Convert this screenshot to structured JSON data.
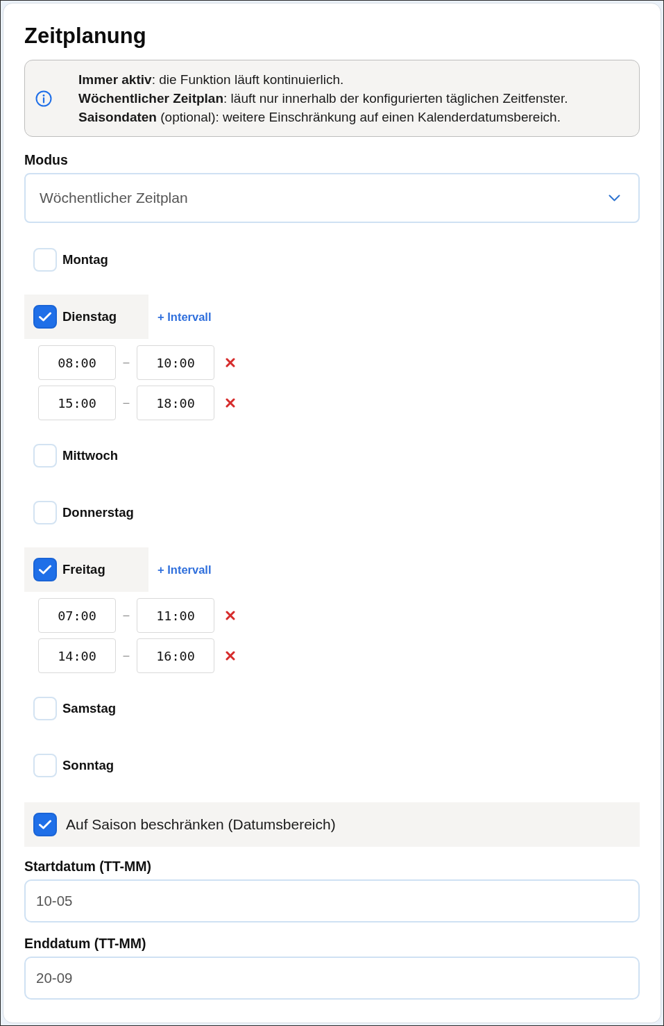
{
  "title": "Zeitplanung",
  "info": {
    "lines": [
      "**Immer aktiv**: die Funktion läuft kontinuierlich.",
      "**Wöchentlicher Zeitplan**: läuft nur innerhalb der konfigurierten täglichen Zeitfenster.",
      "**Saisondaten** (optional): weitere Einschränkung auf einen Kalenderdatumsbereich."
    ]
  },
  "mode": {
    "label": "Modus",
    "value": "Wöchentlicher Zeitplan"
  },
  "days": [
    {
      "label": "Montag",
      "checked": false
    },
    {
      "label": "Dienstag",
      "checked": true,
      "add_label": "+ Intervall",
      "intervals": [
        {
          "start": "08:00",
          "separator": "–",
          "end": "10:00"
        },
        {
          "start": "15:00",
          "separator": "–",
          "end": "18:00"
        }
      ]
    },
    {
      "label": "Mittwoch",
      "checked": false
    },
    {
      "label": "Donnerstag",
      "checked": false
    },
    {
      "label": "Freitag",
      "checked": true,
      "add_label": "+ Intervall",
      "intervals": [
        {
          "start": "07:00",
          "separator": "–",
          "end": "11:00"
        },
        {
          "start": "14:00",
          "separator": "–",
          "end": "16:00"
        }
      ]
    },
    {
      "label": "Samstag",
      "checked": false
    },
    {
      "label": "Sonntag",
      "checked": false
    }
  ],
  "season": {
    "label": "Auf Saison beschränken (Datumsbereich)",
    "checked": true
  },
  "start_date": {
    "label": "Startdatum (TT-MM)",
    "value": "10-05"
  },
  "end_date": {
    "label": "Enddatum (TT-MM)",
    "value": "20-09"
  }
}
